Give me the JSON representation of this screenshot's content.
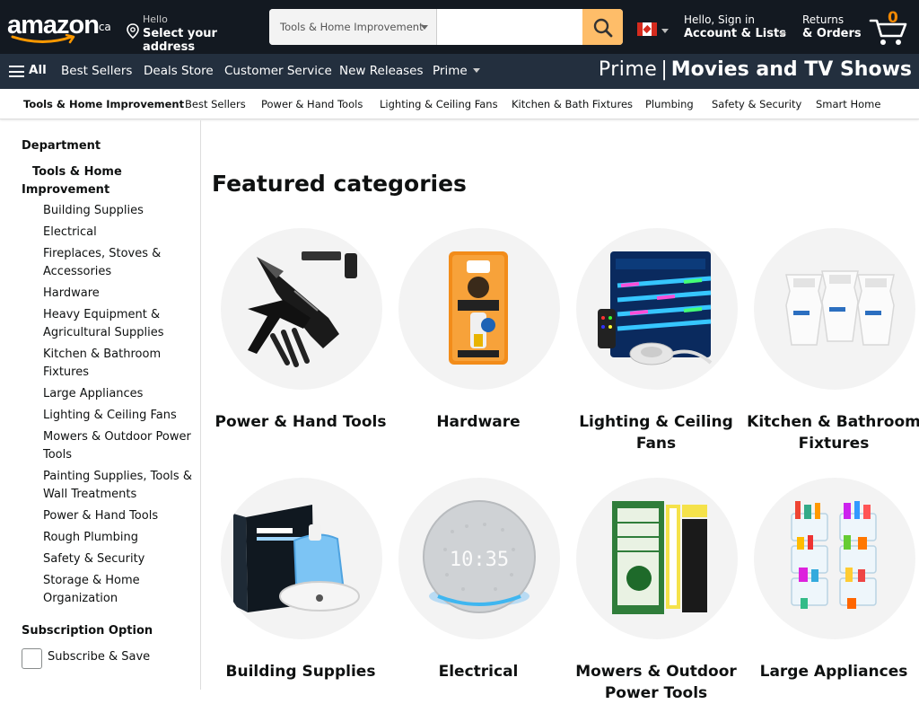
{
  "header": {
    "logo_text": "amazon",
    "logo_tld": ".ca",
    "deliver_line1": "Hello",
    "deliver_line2": "Select your address",
    "search_dept": "Tools & Home Improvement",
    "search_placeholder": "",
    "flag": "canada-flag-icon",
    "account_line1": "Hello, Sign in",
    "account_line2": "Account & Lists",
    "returns_line1": "Returns",
    "returns_line2": "& Orders",
    "cart_count": "0",
    "colors": {
      "nav_dark": "#131921",
      "nav_mid": "#232f3e",
      "search_button": "#febd69",
      "cart_count": "#f08804"
    }
  },
  "main_nav": {
    "all_label": "All",
    "items": [
      "Best Sellers",
      "Deals Store",
      "Customer Service",
      "New Releases",
      "Prime"
    ],
    "banner_prime": "Prime",
    "banner_sep": "|",
    "banner_text": "Movies and TV Shows"
  },
  "sub_nav": {
    "items": [
      "Tools & Home Improvement",
      "Best Sellers",
      "Power & Hand Tools",
      "Lighting & Ceiling Fans",
      "Kitchen & Bath Fixtures",
      "Plumbing",
      "Safety & Security",
      "Smart Home"
    ]
  },
  "sidebar": {
    "department_heading": "Department",
    "parent_line1": "Tools & Home",
    "parent_line2": "Improvement",
    "items": [
      "Building Supplies",
      "Electrical",
      "Fireplaces, Stoves & Accessories",
      "Hardware",
      "Heavy Equipment & Agricultural Supplies",
      "Kitchen & Bathroom Fixtures",
      "Large Appliances",
      "Lighting & Ceiling Fans",
      "Mowers & Outdoor Power Tools",
      "Painting Supplies, Tools & Wall Treatments",
      "Power & Hand Tools",
      "Rough Plumbing",
      "Safety & Security",
      "Storage & Home Organization"
    ],
    "subscription_heading": "Subscription Option",
    "subscribe_label": "Subscribe & Save",
    "subscribe_checked": false
  },
  "main": {
    "title": "Featured categories",
    "categories": [
      {
        "label": "Power & Hand Tools",
        "icon": "multitool-knife-icon"
      },
      {
        "label": "Hardware",
        "icon": "gorilla-glue-icon"
      },
      {
        "label": "Lighting & Ceiling Fans",
        "icon": "led-strip-lights-icon"
      },
      {
        "label": "Kitchen & Bathroom Fixtures",
        "icon": "water-filters-icon"
      },
      {
        "label": "Building Supplies",
        "icon": "humidifier-icon"
      },
      {
        "label": "Electrical",
        "icon": "smart-speaker-icon"
      },
      {
        "label": "Mowers & Outdoor Power Tools",
        "icon": "air-filter-icon"
      },
      {
        "label": "Large Appliances",
        "icon": "fridge-bins-icon"
      }
    ]
  }
}
